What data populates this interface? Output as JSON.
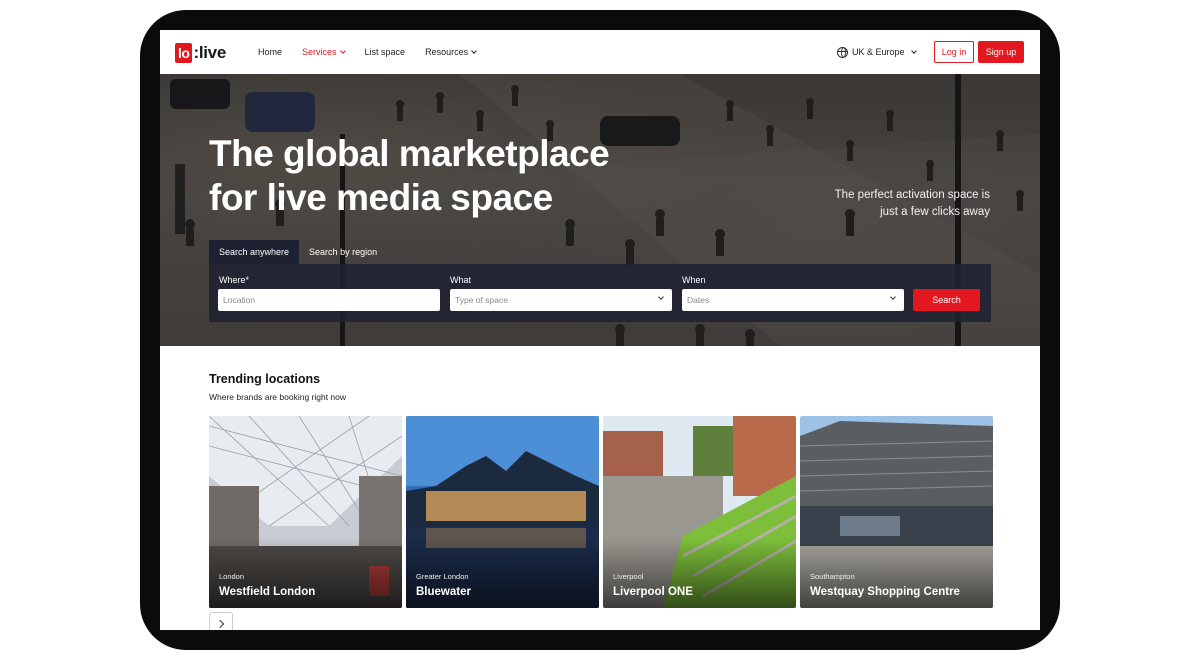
{
  "nav": {
    "logo_box": "lo",
    "logo_rest": ":live",
    "links": [
      {
        "label": "Home"
      },
      {
        "label": "Services"
      },
      {
        "label": "List space"
      },
      {
        "label": "Resources"
      }
    ],
    "region": "UK & Europe",
    "login": "Log in",
    "signup": "Sign up"
  },
  "hero": {
    "title_line1": "The global marketplace",
    "title_line2": "for live media space",
    "subtitle_line1": "The perfect activation space is",
    "subtitle_line2": "just a few clicks away",
    "tabs": [
      {
        "label": "Search anywhere"
      },
      {
        "label": "Search by region"
      }
    ],
    "search": {
      "where_label": "Where*",
      "where_placeholder": "Location",
      "what_label": "What",
      "what_placeholder": "Type of space",
      "when_label": "When",
      "when_placeholder": "Dates",
      "button": "Search"
    }
  },
  "trending": {
    "title": "Trending locations",
    "subtitle": "Where brands are booking right now",
    "cards": [
      {
        "city": "London",
        "name": "Westfield London"
      },
      {
        "city": "Greater London",
        "name": "Bluewater"
      },
      {
        "city": "Liverpool",
        "name": "Liverpool ONE"
      },
      {
        "city": "Southampton",
        "name": "Westquay Shopping Centre"
      }
    ]
  },
  "colors": {
    "brand_red": "#e3171f",
    "search_panel": "#1e2131"
  },
  "icons": [
    "globe-icon",
    "chevron-down-icon",
    "chevron-right-icon"
  ]
}
